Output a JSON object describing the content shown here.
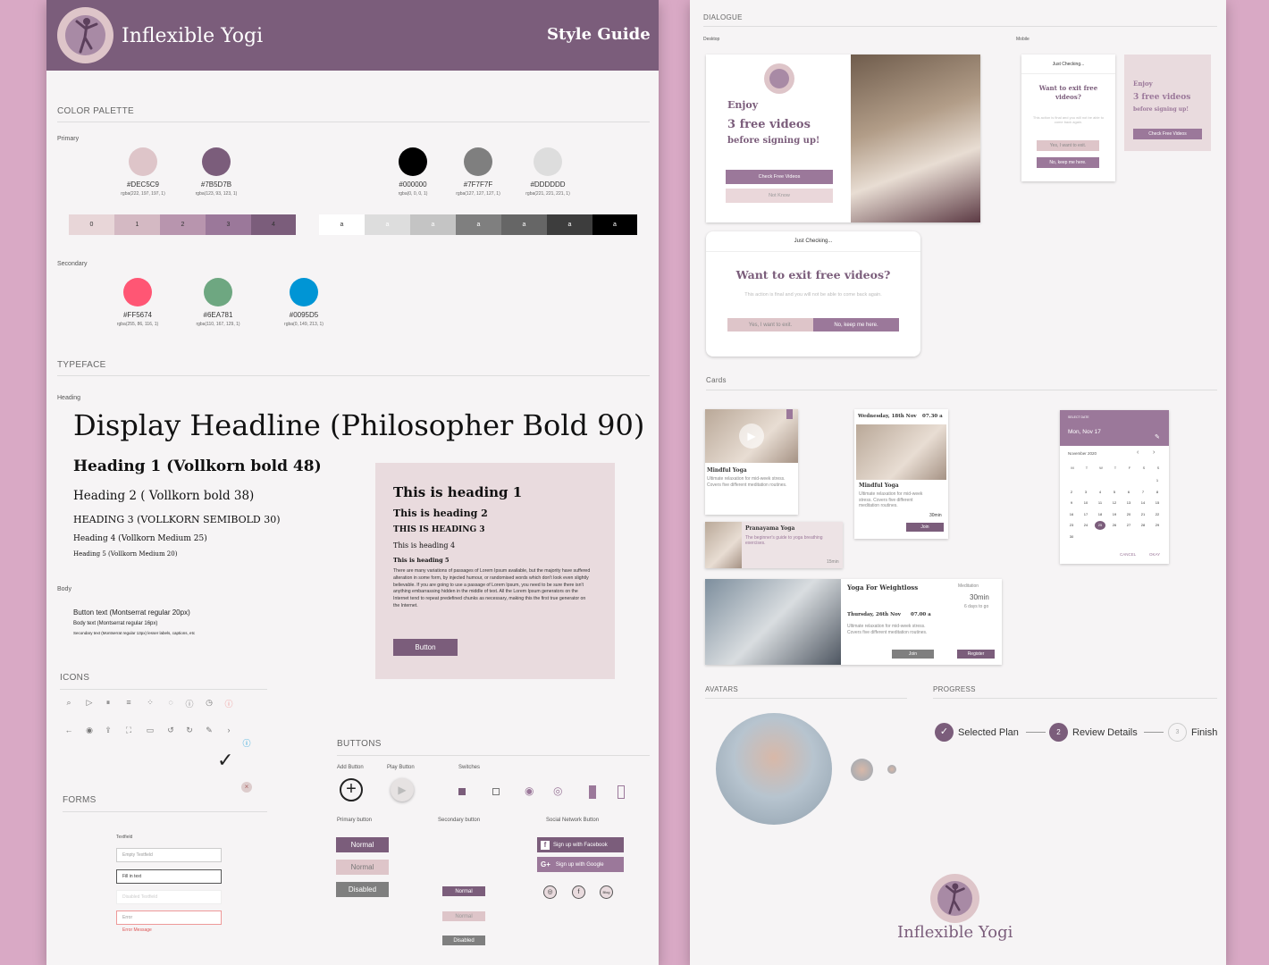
{
  "brand": {
    "name": "Inflexible Yogi",
    "doc_title": "Style Guide"
  },
  "colors": {
    "primary_light": "#DEC5C9",
    "primary_dark": "#7B5D7B",
    "coral": "#FF5674",
    "green": "#6EA781",
    "blue": "#0095D5"
  },
  "palette": {
    "title": "COLOR PALETTE",
    "primary_label": "Primary",
    "secondary_label": "Secondary",
    "primary": [
      {
        "hex": "#DEC5C9",
        "rgba": "rgba(222, 197, 197, 1)",
        "color": "#DEC5C9"
      },
      {
        "hex": "#7B5D7B",
        "rgba": "rgba(123, 93, 123, 1)",
        "color": "#7B5D7B"
      },
      {
        "hex": "#000000",
        "rgba": "rgba(0, 0, 0, 1)",
        "color": "#000000"
      },
      {
        "hex": "#7F7F7F",
        "rgba": "rgba(127, 127, 127, 1)",
        "color": "#7F7F7F"
      },
      {
        "hex": "#DDDDDD",
        "rgba": "rgba(221, 221, 221, 1)",
        "color": "#DDDDDD"
      }
    ],
    "tints": [
      "0",
      "1",
      "2",
      "3",
      "4"
    ],
    "greys": [
      "a",
      "a",
      "a",
      "a",
      "a",
      "a",
      "a"
    ],
    "secondary": [
      {
        "hex": "#FF5674",
        "rgba": "rgba(255, 86, 116, 1)",
        "color": "#FF5674"
      },
      {
        "hex": "#6EA781",
        "rgba": "rgba(110, 167, 129, 1)",
        "color": "#6EA781"
      },
      {
        "hex": "#0095D5",
        "rgba": "rgba(0, 149, 213, 1)",
        "color": "#0095D5"
      }
    ]
  },
  "typeface": {
    "title": "TYPEFACE",
    "heading_label": "Heading",
    "display": "Display Headline (Philosopher Bold 90)",
    "h1": "Heading 1 (Vollkorn bold 48)",
    "h2": "Heading 2 ( Vollkorn bold 38)",
    "h3": "HEADING 3 (VOLLKORN SEMIBOLD 30)",
    "h4": "Heading 4  (Vollkorn Medium 25)",
    "h5": "Heading 5 (Vollkorn Medium 20)",
    "body_label": "Body",
    "body1": "Button text (Montserrat regular 20px)",
    "body2": "Body text (Montserrat regular 16px)",
    "body3": "Secondary text (Montserrat regular 13px) lesser labels, captions, etc"
  },
  "sample": {
    "h1": "This is heading 1",
    "h2": "This is heading 2",
    "h3": "THIS IS HEADING 3",
    "h4": "This is heading 4",
    "h5": "This is heading 5",
    "paragraph": "There are many variations of passages of Lorem Ipsum available, but the majority have suffered alteration in some form, by injected humour, or randomised words which don't look even slightly believable. If you are going to use a passage of Lorem Ipsum, you need to be sure there isn't anything embarrassing hidden in the middle of text. All the Lorem Ipsum generators on the Internet tend to repeat predefined chunks as necessary, making this the first true generator on the Internet.",
    "button": "Button"
  },
  "icons_title": "ICONS",
  "forms": {
    "title": "FORMS",
    "label": "Textfield",
    "empty": "Empty Textfield",
    "filled": "Fill in text",
    "disabled": "Disabled Textfield",
    "error": "Error",
    "error_msg": "Error Message"
  },
  "buttons": {
    "title": "BUTTONS",
    "add": "Add Button",
    "play": "Play Button",
    "switches": "Switches",
    "primary": "Primary button",
    "secondary": "Secondary button",
    "social": "Social Network Button",
    "normal": "Normal",
    "disabled": "Disabled",
    "facebook": "Sign up with Facebook",
    "google": "Sign up with Google",
    "blog": "Blog"
  },
  "dialogue": {
    "title": "DIALOGUE",
    "desktop": "Desktop",
    "mobile": "Mobile",
    "enjoy": "Enjoy",
    "videos": "3 free videos",
    "before": "before signing up!",
    "check": "Check Free Videos",
    "not_know": "Not Know",
    "just": "Just Checking...",
    "exit_q": "Want to exit free videos?",
    "exit_q_mobile": "Want to exit free videos?",
    "final": "This action is final and you will not be able to come back again.",
    "yes": "Yes, I want to exit.",
    "no": "No, keep me here."
  },
  "cards": {
    "title": "Cards",
    "c1_title": "Mindful Yoga",
    "c1_text": "Ultimate relaxation for mid-week stress. Covers five different meditation routines.",
    "c2_date": "Wednesday, 18th Nov",
    "c2_time": "07.30 a",
    "c2_title": "Mindful Yoga",
    "c2_text": "Ultimate relaxation for mid-week stress. Covers five different meditation routines.",
    "c2_dur": "30min",
    "c2_join": "Join",
    "c3_title": "Pranayama Yoga",
    "c3_text": "The beginner's guide to yoga breathing exercises.",
    "c3_dur": "15min",
    "c4_title": "Yoga For Weightloss",
    "c4_tag": "Meditation",
    "c4_dur": "30min",
    "c4_days": "6 days to go",
    "c4_date": "Thursday, 26th Nov",
    "c4_time": "07.00 a",
    "c4_text": "Ultimate relaxation for mid-week stress. Covers five different meditation routines.",
    "c4_join": "Join",
    "c4_register": "Register"
  },
  "calendar": {
    "header_label": "SELECT DATE",
    "header_date": "Mon, Nov 17",
    "month": "November 2020",
    "weekdays": [
      "M",
      "T",
      "W",
      "T",
      "F",
      "S",
      "S"
    ],
    "days": [
      "1",
      "2",
      "3",
      "4",
      "5",
      "6",
      "7",
      "8",
      "9",
      "10",
      "11",
      "12",
      "13",
      "14",
      "15",
      "16",
      "17",
      "18",
      "19",
      "20",
      "21",
      "22",
      "23",
      "24",
      "25",
      "26",
      "27",
      "28",
      "29",
      "30"
    ],
    "selected": "25",
    "cancel": "CANCEL",
    "okay": "OKAY"
  },
  "avatars_title": "AVATARS",
  "progress": {
    "title": "PROGRESS",
    "step1": "Selected Plan",
    "step2": "Review Details",
    "step2_num": "2",
    "step3": "Finish",
    "step3_num": "3"
  }
}
